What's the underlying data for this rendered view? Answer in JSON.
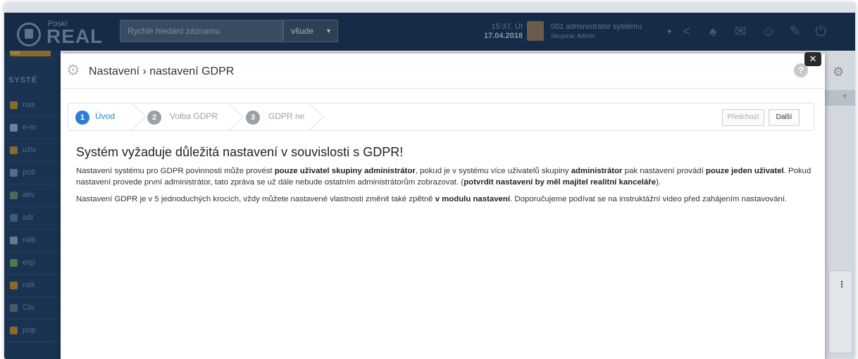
{
  "header": {
    "logo_small": "Poskí",
    "logo_big": "REAL",
    "search_placeholder": "Rychlé hledání záznamu",
    "search_scope": "všude",
    "time": "15:37, Út",
    "date": "17.04.2018",
    "user_name": "001 administrátor systému",
    "user_group": "Skupina: Admin",
    "icons": [
      "share-icon",
      "bell-icon",
      "mail-icon",
      "users-icon",
      "edit-icon",
      "power-icon"
    ]
  },
  "sidebar": {
    "top_tab": "Nast",
    "heading": "SYSTÉ",
    "items": [
      {
        "label": "nas",
        "icon": "gear-icon",
        "color": "#8a6a2a"
      },
      {
        "label": "e-m",
        "icon": "mail-icon",
        "color": "#6a7f9a"
      },
      {
        "label": "uživ",
        "icon": "users-icon",
        "color": "#8a6a2a"
      },
      {
        "label": "pob",
        "icon": "building-icon",
        "color": "#5a6a8a"
      },
      {
        "label": "akv",
        "icon": "globe-icon",
        "color": "#4a6a5a"
      },
      {
        "label": "adr",
        "icon": "address-icon",
        "color": "#3a5a7a"
      },
      {
        "label": "nab",
        "icon": "offer-icon",
        "color": "#6a7a8a"
      },
      {
        "label": "exp",
        "icon": "export-icon",
        "color": "#4a7a4a"
      },
      {
        "label": "nák",
        "icon": "cart-icon",
        "color": "#8a6a2a"
      },
      {
        "label": "Clo",
        "icon": "cloud-icon",
        "color": "#4a5a6a"
      },
      {
        "label": "pop",
        "icon": "gift-icon",
        "color": "#8a6a2a"
      }
    ]
  },
  "modal": {
    "breadcrumb": "Nastavení › nastavení GDPR",
    "help": "?",
    "close": "✕"
  },
  "wizard": {
    "steps": [
      {
        "number": "1",
        "label": "Úvod",
        "active": true
      },
      {
        "number": "2",
        "label": "Volba GDPR",
        "active": false
      },
      {
        "number": "3",
        "label": "GDPR ne",
        "active": false
      }
    ],
    "prev_label": "Předchozí",
    "next_label": "Další"
  },
  "content": {
    "heading": "Systém vyžaduje důležitá nastavení v souvislosti s GDPR!",
    "p1": [
      {
        "t": "Nastavení systému pro GDPR povinnosti může provést ",
        "b": false
      },
      {
        "t": "pouze uživatel skupiny administrátor",
        "b": true
      },
      {
        "t": ", pokud je v systému více uživatelů skupiny ",
        "b": false
      },
      {
        "t": "administrátor",
        "b": true
      },
      {
        "t": " pak nastavení provádí ",
        "b": false
      },
      {
        "t": "pouze jeden uživatel",
        "b": true
      },
      {
        "t": ". Pokud nastavení provede první administrátor, tato zpráva se už dále nebude ostatním administrátorům zobrazovat. (",
        "b": false
      },
      {
        "t": "potvrdit nastavení by měl majitel realitní kanceláře",
        "b": true
      },
      {
        "t": ").",
        "b": false
      }
    ],
    "p2": [
      {
        "t": "Nastavení GDPR je v 5 jednoduchých krocích, vždy můžete nastavené vlastnosti změnit také zpětně ",
        "b": false
      },
      {
        "t": "v modulu nastavení",
        "b": true
      },
      {
        "t": ". Doporučujeme podívat se na instruktážní video před zahájením nastavování.",
        "b": false
      }
    ]
  },
  "colors": {
    "header_bg": "#152b48",
    "step_active": "#2f7dd1",
    "step_inactive": "#9aa0a6",
    "accent_text": "#2f7dd1"
  }
}
